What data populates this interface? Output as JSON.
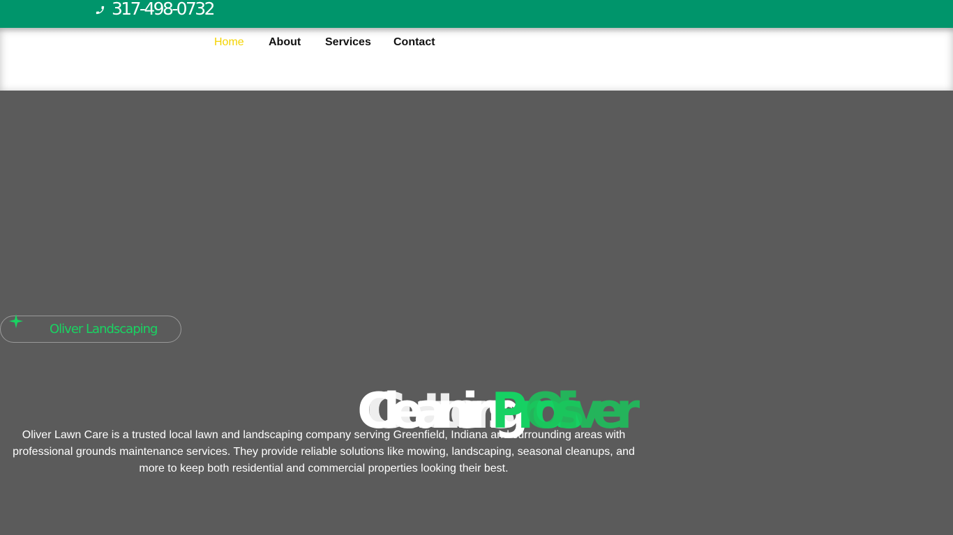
{
  "topbar": {
    "phone_icon": "phone-icon",
    "phone": "317-498-0732",
    "background": "#00956b"
  },
  "nav": {
    "items": [
      {
        "label": "Home",
        "active": true
      },
      {
        "label": "About",
        "active": false
      },
      {
        "label": "Services",
        "active": false
      },
      {
        "label": "Contact",
        "active": false
      }
    ],
    "active_color": "#f4d300"
  },
  "hero": {
    "badge": {
      "icon": "sparkle-icon",
      "label": "Oliver Landscaping"
    },
    "headline": {
      "white_a": "Cleaning",
      "white_b": "Gutters",
      "green_a": "Pros",
      "green_b": "Oliver"
    },
    "description": "Oliver Lawn Care is a trusted local lawn and landscaping company serving Greenfield, Indiana and surrounding areas with professional grounds maintenance services. They provide reliable solutions like mowing, landscaping, seasonal cleanups, and more to keep both residential and commercial properties looking their best.",
    "accent": "#19d462",
    "background": "#5b5b5b"
  }
}
